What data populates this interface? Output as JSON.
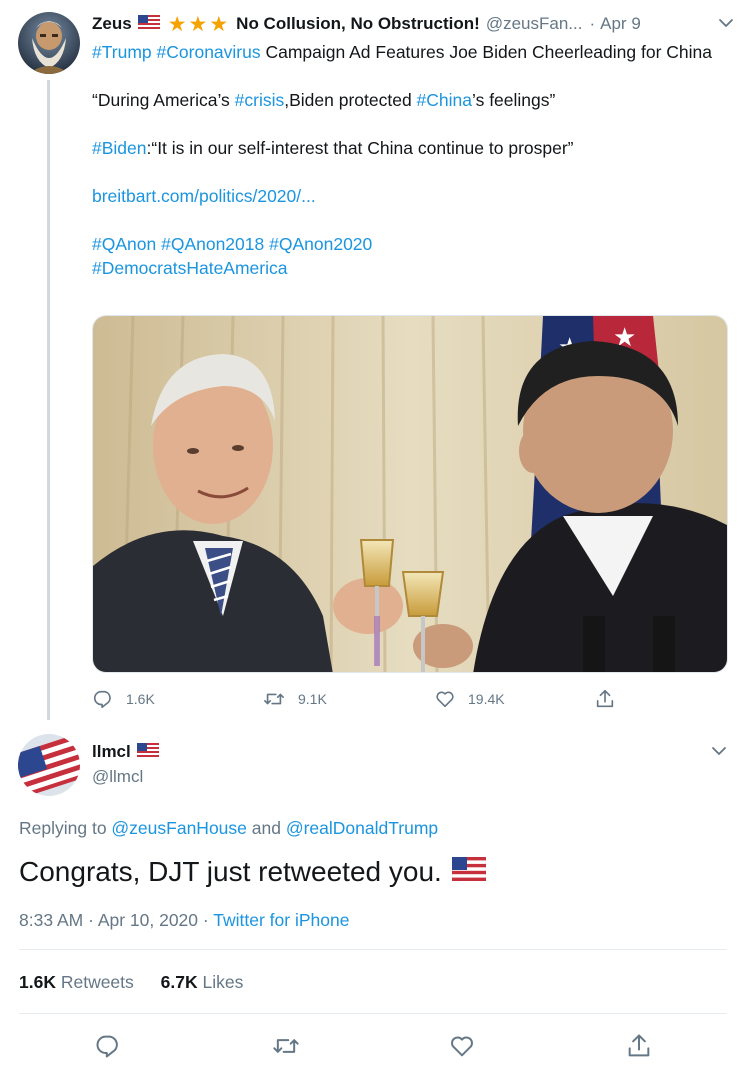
{
  "parent_tweet": {
    "author_name": "Zeus",
    "author_title": "No Collusion, No Obstruction!",
    "handle": "@zeusFan...",
    "separator": "·",
    "date": "Apr 9",
    "hashtag_trump": "#Trump",
    "hashtag_coronavirus": "#Coronavirus",
    "headline_rest": " Campaign Ad Features Joe Biden Cheerleading for China",
    "quote_open": "“During America’s ",
    "hashtag_crisis": "#crisis",
    "quote_mid": ",Biden protected ",
    "hashtag_china": "#China",
    "quote_end": "’s feelings”",
    "hashtag_biden": "#Biden",
    "biden_quote": ":“It is in our self-interest that China continue to prosper”",
    "link": "breitbart.com/politics/2020/...",
    "hashtag_qanon": "#QAnon",
    "hashtag_qanon2018": "#QAnon2018",
    "hashtag_qanon2020": "#QAnon2020",
    "hashtag_democrats": "#DemocratsHateAmerica",
    "reply_count": "1.6K",
    "retweet_count": "9.1K",
    "like_count": "19.4K",
    "icons": {
      "reply": "reply-icon",
      "retweet": "retweet-icon",
      "like": "heart-icon",
      "share": "share-icon"
    }
  },
  "focal_tweet": {
    "author_name": "llmcl",
    "handle": "@llmcl",
    "replying_label": "Replying to ",
    "reply_user_1": "@zeusFanHouse",
    "reply_and": " and ",
    "reply_user_2": "@realDonaldTrump",
    "text": "Congrats, DJT just retweeted you.",
    "time": "8:33 AM",
    "meta_sep": " · ",
    "date": "Apr 10, 2020",
    "source": "Twitter for iPhone",
    "retweets_count": "1.6K",
    "retweets_label": " Retweets",
    "likes_count": "6.7K",
    "likes_label": " Likes"
  },
  "colors": {
    "link": "#1b95e0",
    "secondary": "#657786",
    "primary_text": "#14171a",
    "star": "#f5a300"
  }
}
